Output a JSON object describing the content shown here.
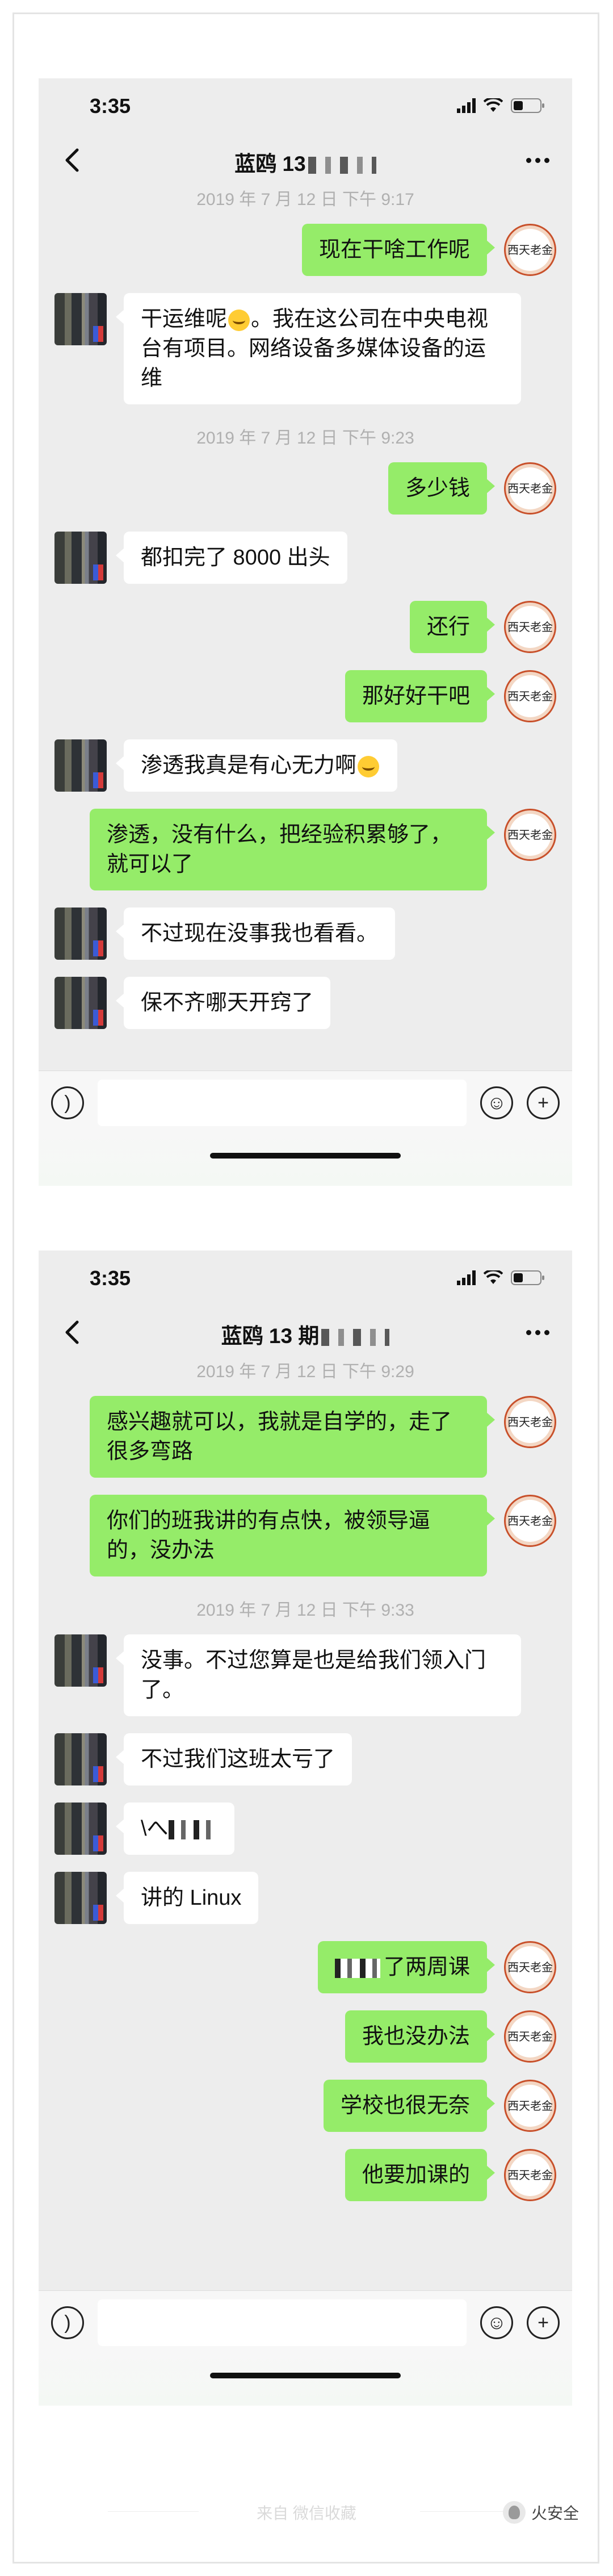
{
  "phone1": {
    "status_time": "3:35",
    "title": "蓝鸥 13",
    "input_placeholder": "",
    "timestamps": [
      "2019 年 7 月 12 日 下午 9:17",
      "2019 年 7 月 12 日 下午 9:23"
    ],
    "messages": [
      {
        "text": "现在干啥工作呢"
      },
      {
        "text_a": "干运维呢",
        "text_b": "。我在这公司在中央电视台有项目。网络设备多媒体设备的运维"
      },
      {
        "text": "多少钱"
      },
      {
        "text": "都扣完了 8000 出头"
      },
      {
        "text": "还行"
      },
      {
        "text": "那好好干吧"
      },
      {
        "text": "渗透我真是有心无力啊"
      },
      {
        "text": "渗透，没有什么，把经验积累够了，就可以了"
      },
      {
        "text": "不过现在没事我也看看。"
      },
      {
        "text": "保不齐哪天开窍了"
      }
    ]
  },
  "phone2": {
    "status_time": "3:35",
    "title": "蓝鸥 13 期",
    "timestamps": [
      "2019 年 7 月 12 日 下午 9:29",
      "2019 年 7 月 12 日 下午 9:33"
    ],
    "messages": [
      {
        "text": "感兴趣就可以，我就是自学的，走了很多弯路"
      },
      {
        "text": "你们的班我讲的有点快，被领导逼的，没办法"
      },
      {
        "text": "没事。不过您算是也是给我们领入门了。"
      },
      {
        "text": "不过我们这班太亏了"
      },
      {
        "text": "\\へ"
      },
      {
        "text": "讲的 Linux"
      },
      {
        "text": "了两周课"
      },
      {
        "text": "我也没办法"
      },
      {
        "text": "学校也很无奈"
      },
      {
        "text": "他要加课的"
      }
    ]
  },
  "avatar_text": "西天老金",
  "footer": {
    "text": "来自 微信收藏",
    "brand": "火安全"
  },
  "colors": {
    "bubble_out": "#95ec69",
    "bubble_in": "#ffffff",
    "chat_bg": "#ededed"
  }
}
